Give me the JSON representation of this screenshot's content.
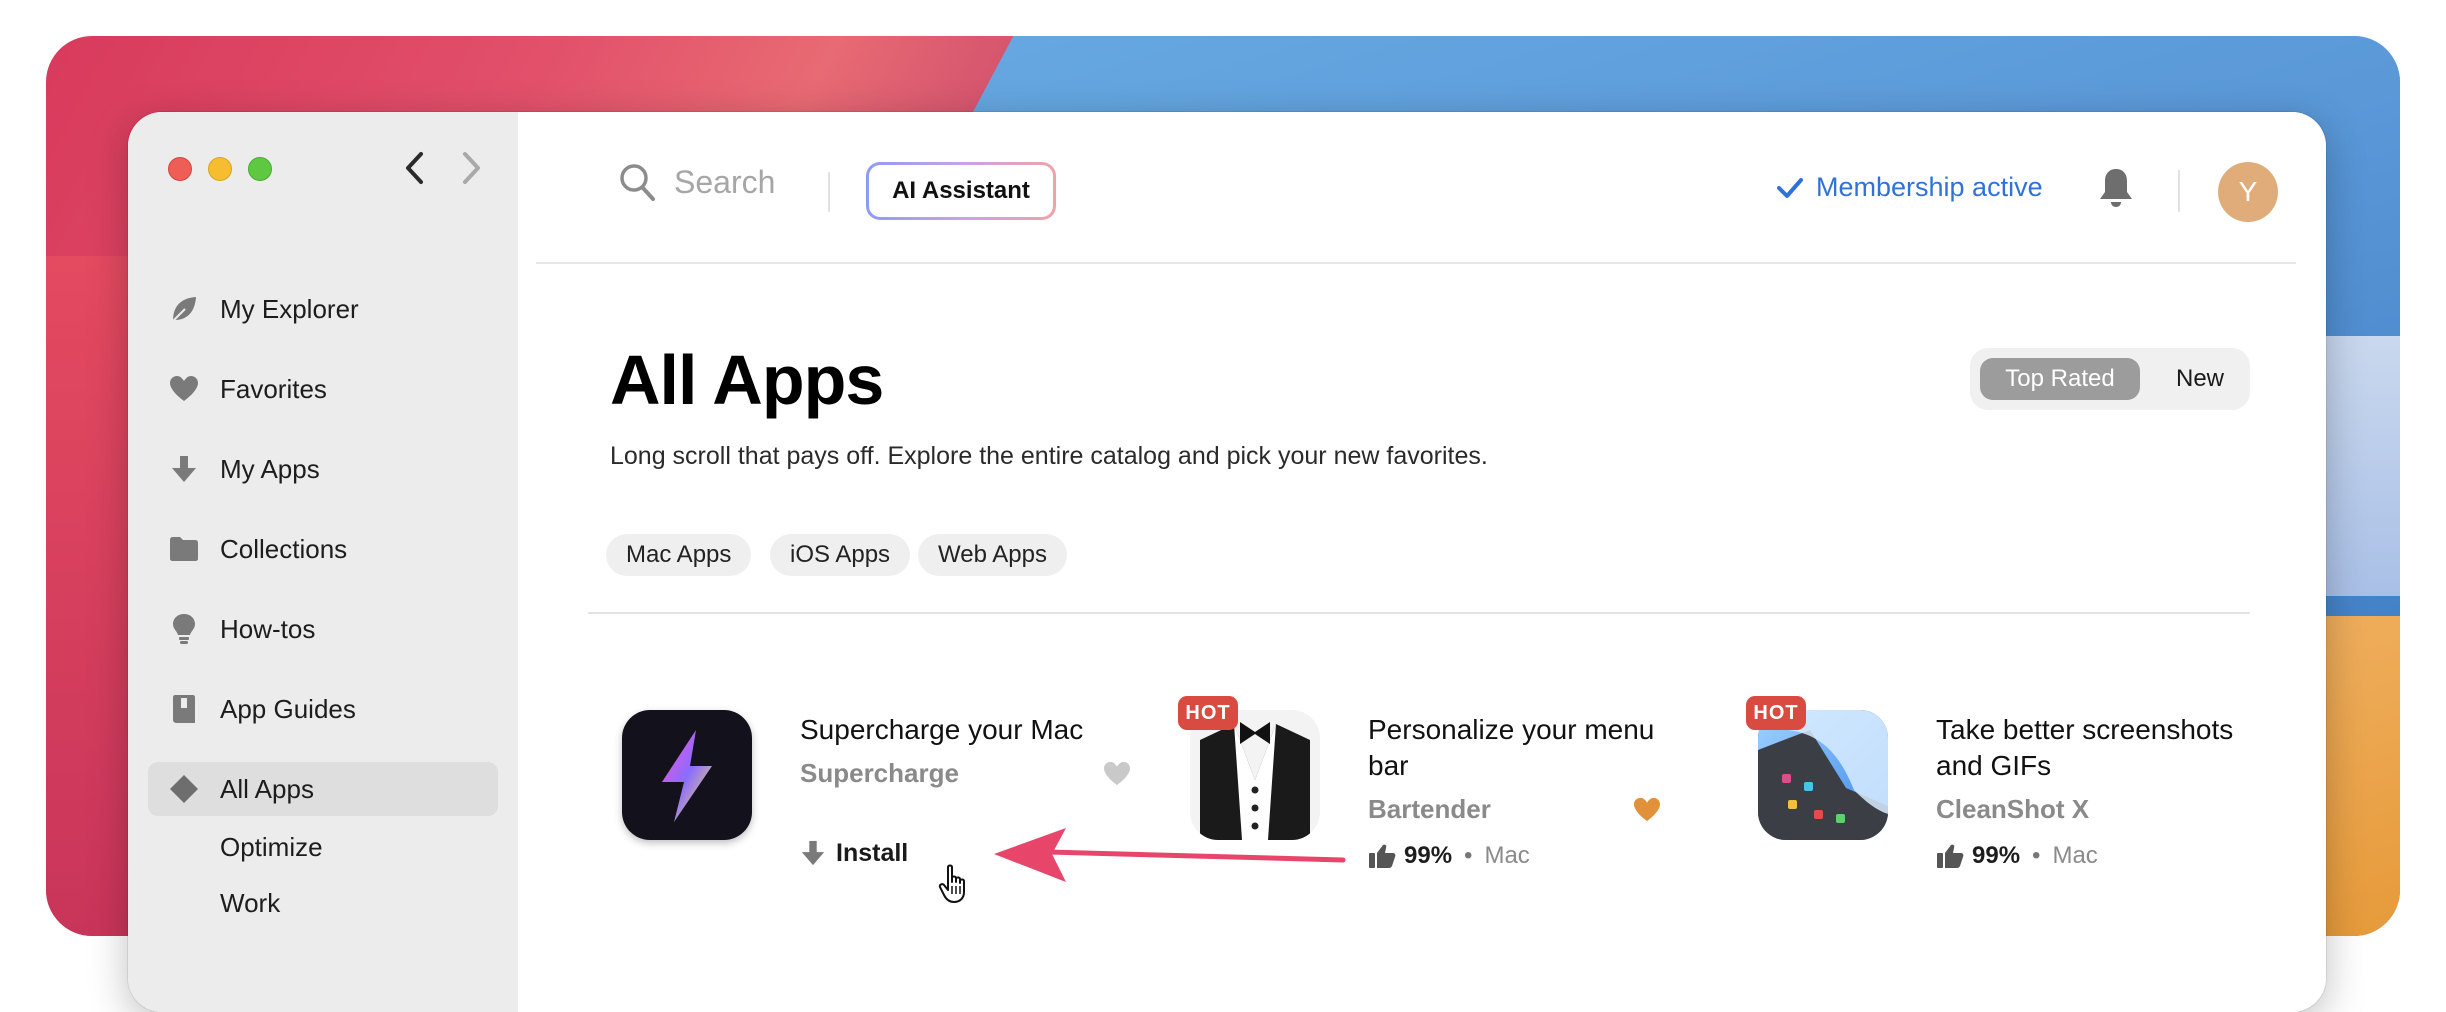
{
  "window": {
    "traffic_lights": [
      "close",
      "minimize",
      "maximize"
    ],
    "nav": {
      "back_icon": "chevron-left-icon",
      "forward_icon": "chevron-right-icon"
    }
  },
  "sidebar": {
    "items": [
      {
        "label": "My Explorer",
        "icon": "leaf-icon"
      },
      {
        "label": "Favorites",
        "icon": "heart-icon"
      },
      {
        "label": "My Apps",
        "icon": "download-arrow-icon"
      },
      {
        "label": "Collections",
        "icon": "folder-icon"
      },
      {
        "label": "How-tos",
        "icon": "lightbulb-icon"
      },
      {
        "label": "App Guides",
        "icon": "book-icon"
      },
      {
        "label": "All Apps",
        "icon": "diamond-icon",
        "active": true
      }
    ],
    "subitems": [
      "Optimize",
      "Work"
    ]
  },
  "header": {
    "search_placeholder": "Search",
    "ai_button": "AI Assistant",
    "membership": "Membership active",
    "avatar_letter": "Y"
  },
  "page": {
    "title": "All Apps",
    "subtitle": "Long scroll that pays off. Explore the entire catalog and pick your new favorites.",
    "sort": {
      "options": [
        "Top Rated",
        "New"
      ],
      "selected": "Top Rated"
    },
    "filters": [
      "Mac Apps",
      "iOS Apps",
      "Web Apps"
    ]
  },
  "apps": [
    {
      "title": "Supercharge your Mac",
      "name": "Supercharge",
      "action": "Install",
      "favorite": false
    },
    {
      "title": "Personalize your menu bar",
      "name": "Bartender",
      "badge": "HOT",
      "rating": "99%",
      "platform": "Mac",
      "favorite": true
    },
    {
      "title": "Take better screenshots and GIFs",
      "name": "CleanShot X",
      "badge": "HOT",
      "rating": "99%",
      "platform": "Mac"
    }
  ],
  "colors": {
    "accent_blue": "#2f73d8",
    "hot_badge": "#d94b40",
    "annotation_arrow": "#e8456a",
    "avatar": "#e0ad7a"
  }
}
